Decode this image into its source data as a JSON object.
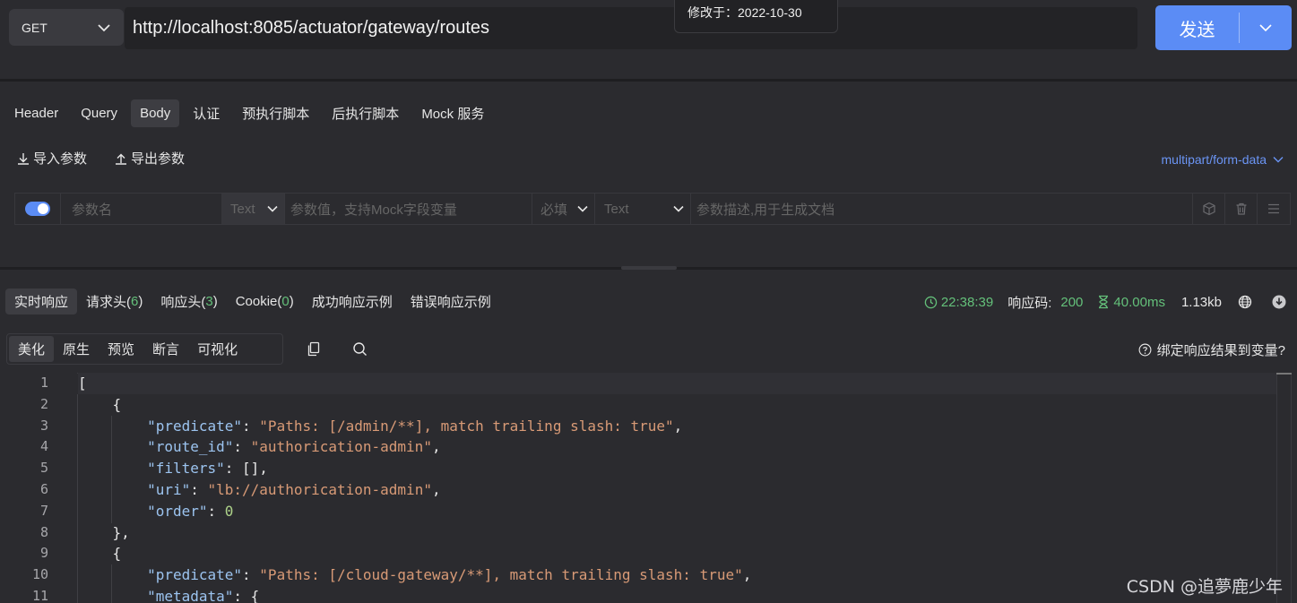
{
  "request": {
    "method": "GET",
    "url": "http://localhost:8085/actuator/gateway/routes",
    "tooltip": "修改于：2022-10-30",
    "send_label": "发送"
  },
  "request_tabs": [
    "Header",
    "Query",
    "Body",
    "认证",
    "预执行脚本",
    "后执行脚本",
    "Mock 服务"
  ],
  "active_request_tab": "Body",
  "body": {
    "import_label": "导入参数",
    "export_label": "导出参数",
    "content_type": "multipart/form-data",
    "param": {
      "name_placeholder": "参数名",
      "type": "Text",
      "value_placeholder": "参数值，支持Mock字段变量",
      "required": "必填",
      "value_type": "Text",
      "desc_placeholder": "参数描述,用于生成文档"
    }
  },
  "response_tabs": [
    {
      "label": "实时响应",
      "count": null
    },
    {
      "label": "请求头(",
      "count": "6",
      "suffix": ")"
    },
    {
      "label": "响应头(",
      "count": "3",
      "suffix": ")"
    },
    {
      "label": "Cookie(",
      "count": "0",
      "suffix": ")"
    },
    {
      "label": "成功响应示例",
      "count": null
    },
    {
      "label": "错误响应示例",
      "count": null
    }
  ],
  "response_meta": {
    "time": "22:38:39",
    "status_label": "响应码:",
    "status_code": "200",
    "duration": "40.00ms",
    "size": "1.13kb"
  },
  "view_tabs": [
    "美化",
    "原生",
    "预览",
    "断言",
    "可视化"
  ],
  "bind_variable_label": "绑定响应结果到变量?",
  "editor": {
    "line_numbers": [
      "1",
      "2",
      "3",
      "4",
      "5",
      "6",
      "7",
      "8",
      "9",
      "10",
      "11"
    ]
  },
  "watermark": "CSDN @追夢鹿少年",
  "colors": {
    "accent": "#5b8cf5",
    "success": "#64c07a",
    "json_key": "#9cc4f0",
    "json_string": "#d89a76"
  }
}
